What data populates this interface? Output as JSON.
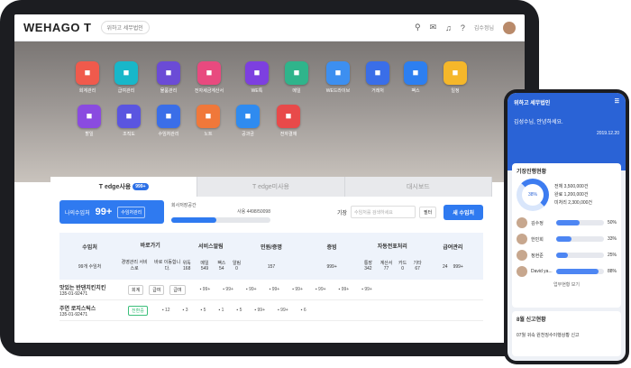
{
  "app": {
    "logo": "WEHAGO T",
    "company": "위하고 세무법인",
    "user": "김수정님"
  },
  "apps": [
    {
      "label": "회계관리",
      "color": "#f05a4c"
    },
    {
      "label": "급여관리",
      "color": "#18b7c9"
    },
    {
      "label": "물품관리",
      "color": "#6b4bd6"
    },
    {
      "label": "전자세금계산서",
      "color": "#e84a7f"
    },
    {
      "label": "WE톡",
      "color": "#7d3fe0"
    },
    {
      "label": "메일",
      "color": "#2fb48b"
    },
    {
      "label": "WE드라이브",
      "color": "#3d8ff0"
    },
    {
      "label": "거래처",
      "color": "#3a6ee8"
    },
    {
      "label": "팩스",
      "color": "#2d7ff0"
    },
    {
      "label": "일정",
      "color": "#f5b72a"
    },
    {
      "label": "할일",
      "color": "#8a4be0"
    },
    {
      "label": "조직도",
      "color": "#5a55e0"
    },
    {
      "label": "수임처관리",
      "color": "#3a6ee8"
    },
    {
      "label": "노트",
      "color": "#f0783a"
    },
    {
      "label": "공과금",
      "color": "#2f8bf0"
    },
    {
      "label": "전자결재",
      "color": "#e84a4a"
    }
  ],
  "tabs": [
    "T edge사용",
    "T edge미사용",
    "대시보드"
  ],
  "tab_badge": "999+",
  "my_clients": {
    "label": "나의수임처",
    "count": "99+",
    "button": "수임처관리"
  },
  "storage": {
    "label": "회사저장공간",
    "usage": "사용 4498/50098",
    "fill": 0.45
  },
  "search": {
    "label": "기장",
    "placeholder": "수임처를 검색하세요",
    "filter": "필터"
  },
  "new_button": "새 수임처",
  "stats": [
    {
      "head": "수임처",
      "values": [
        "99개 수임처"
      ]
    },
    {
      "head": "바로가기",
      "values": [
        "경영관리 서비스로",
        "바로 이동합니다."
      ]
    },
    {
      "head": "서비스알림",
      "values": [
        "위독 168",
        "메일 549",
        "팩스 54",
        "알림 0"
      ]
    },
    {
      "head": "민원/증명",
      "values": [
        "157"
      ]
    },
    {
      "head": "증빙",
      "values": [
        "999+"
      ]
    },
    {
      "head": "자동전표처리",
      "values": [
        "통장 342",
        "계산서 77",
        "카드 0",
        "기타 67"
      ]
    },
    {
      "head": "급여관리",
      "values": [
        "24",
        "999+"
      ]
    }
  ],
  "rows": [
    {
      "name": "맛있는 반댄치킨치킨",
      "id": "135-01-92471",
      "chips": [
        "회계",
        "급여",
        "급여"
      ],
      "cells": [
        "99+",
        "99+",
        "99+",
        "99+",
        "99+",
        "99+",
        "99+",
        "99+"
      ]
    },
    {
      "name": "주연 로지스틱스",
      "id": "135-01-92471",
      "chips": [
        "전환중"
      ],
      "cells": [
        "12",
        "3",
        "5",
        "1",
        "5",
        "99+",
        "99+",
        "6"
      ]
    }
  ],
  "phone": {
    "title": "위하고 세무법인",
    "greeting": "김성수님, 안녕하세요.",
    "date": "2019.12.20",
    "section": "기장진행현황",
    "percent": "38%",
    "totals": [
      {
        "k": "전체",
        "v": "3,500,000건"
      },
      {
        "k": "완료",
        "v": "1,200,000건"
      },
      {
        "k": "미처리",
        "v": "2,300,000건"
      }
    ],
    "people": [
      {
        "name": "김수정",
        "pct": "50%",
        "fill": 0.5
      },
      {
        "name": "한민희",
        "pct": "33%",
        "fill": 0.33
      },
      {
        "name": "정현준",
        "pct": "25%",
        "fill": 0.25
      },
      {
        "name": "David ya...",
        "pct": "88%",
        "fill": 0.88
      }
    ],
    "footer_link": "업무현황 보기",
    "report": "8월 신고현황",
    "report_line": "07월 귀속 원천징수이행상황 신고"
  }
}
